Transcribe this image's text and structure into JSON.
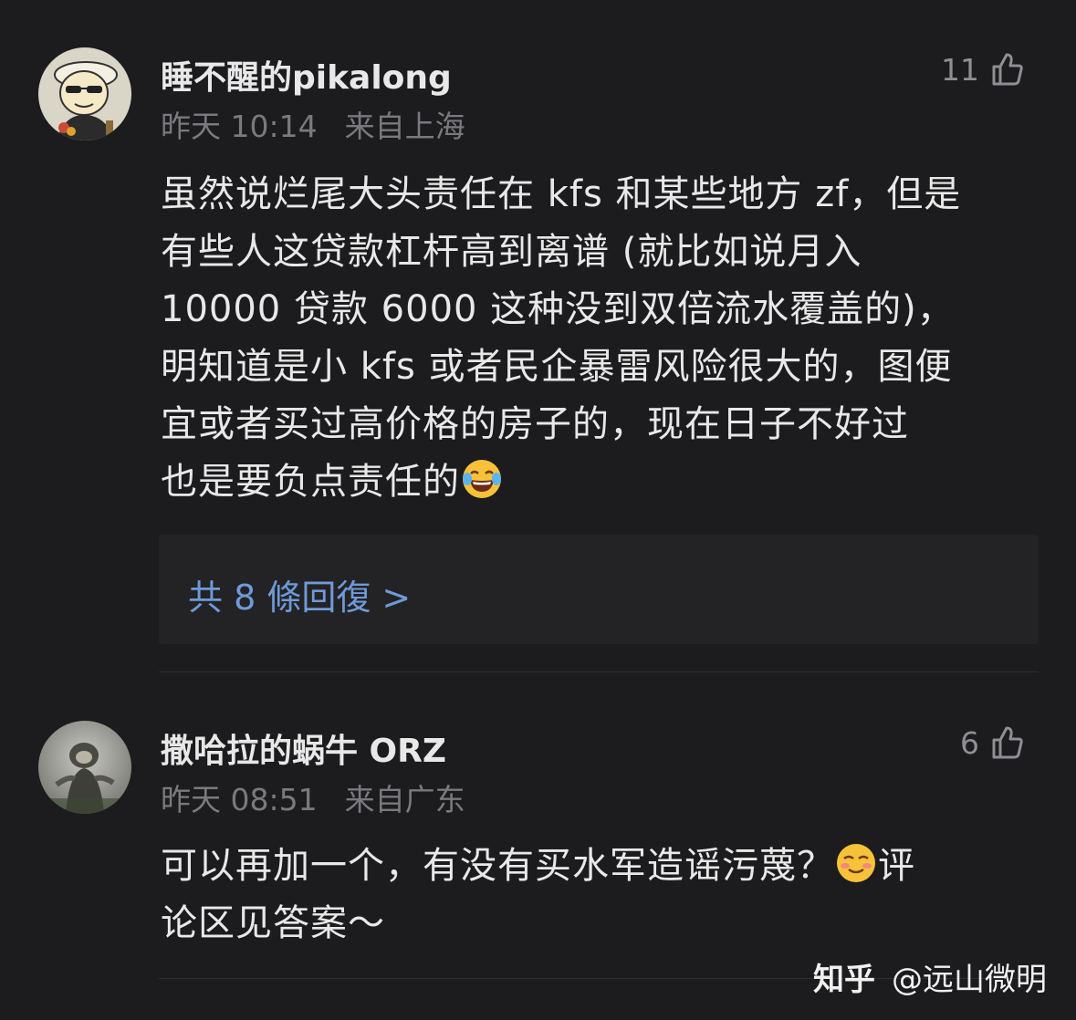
{
  "comments": [
    {
      "username": "睡不醒的pikalong",
      "time": "昨天 10:14",
      "location": "来自上海",
      "likes": "11",
      "lines": [
        "虽然说烂尾大头责任在 kfs 和某些地方 zf，但是",
        "有些人这贷款杠杆高到离谱 (就比如说月入",
        "10000 贷款 6000 这种没到双倍流水覆盖的)，",
        "明知道是小 kfs 或者民企暴雷风险很大的，图便",
        "宜或者买过高价格的房子的，现在日子不好过",
        "也是要负点责任的"
      ],
      "replies_link": "共 8 條回復 >"
    },
    {
      "username": "撒哈拉的蜗牛 ORZ",
      "time": "昨天 08:51",
      "location": "来自广东",
      "likes": "6",
      "line1": "可以再加一个，有没有买水军造谣污蔑？",
      "line1_tail": "评",
      "line2": "论区见答案～"
    }
  ],
  "watermark": {
    "brand": "知乎",
    "author": "@远山微明"
  },
  "icons": {
    "like": "thumbs-up-icon",
    "emoji1": "laughing-crying-emoji",
    "emoji2": "smiling-blush-emoji"
  }
}
